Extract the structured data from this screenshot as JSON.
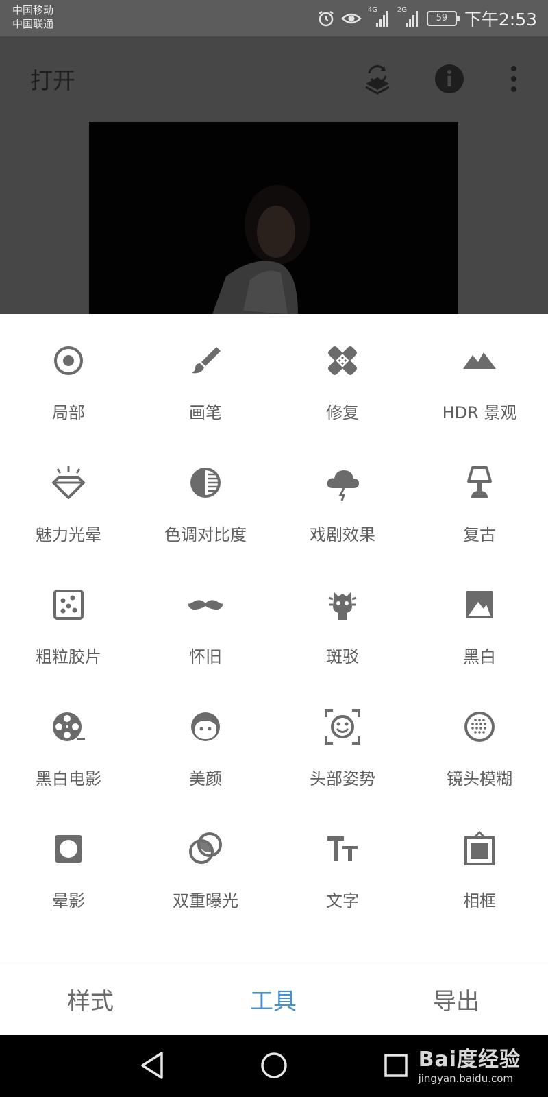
{
  "status_bar": {
    "carrier_1": "中国移动",
    "carrier_2": "中国联通",
    "network_1": "4G",
    "network_2": "2G",
    "battery": "59",
    "time": "下午2:53",
    "icons": [
      "alarm-icon",
      "eye-icon",
      "signal-icon",
      "signal-icon",
      "battery-icon"
    ]
  },
  "header": {
    "open_label": "打开",
    "actions": [
      "layers-icon",
      "info-icon",
      "more-icon"
    ]
  },
  "tools": [
    {
      "label": "局部",
      "icon": "selective-icon"
    },
    {
      "label": "画笔",
      "icon": "brush-icon"
    },
    {
      "label": "修复",
      "icon": "healing-icon"
    },
    {
      "label": "HDR 景观",
      "icon": "mountains-icon"
    },
    {
      "label": "魅力光晕",
      "icon": "diamond-icon"
    },
    {
      "label": "色调对比度",
      "icon": "tonal-contrast-icon"
    },
    {
      "label": "戏剧效果",
      "icon": "cloud-lightning-icon"
    },
    {
      "label": "复古",
      "icon": "lamp-icon"
    },
    {
      "label": "粗粒胶片",
      "icon": "grain-icon"
    },
    {
      "label": "怀旧",
      "icon": "mustache-icon"
    },
    {
      "label": "斑驳",
      "icon": "guitar-icon"
    },
    {
      "label": "黑白",
      "icon": "bw-photo-icon"
    },
    {
      "label": "黑白电影",
      "icon": "film-reel-icon"
    },
    {
      "label": "美颜",
      "icon": "face-icon"
    },
    {
      "label": "头部姿势",
      "icon": "face-frame-icon"
    },
    {
      "label": "镜头模糊",
      "icon": "lens-blur-icon"
    },
    {
      "label": "晕影",
      "icon": "vignette-icon"
    },
    {
      "label": "双重曝光",
      "icon": "double-exposure-icon"
    },
    {
      "label": "文字",
      "icon": "text-icon"
    },
    {
      "label": "相框",
      "icon": "frame-icon"
    }
  ],
  "tabs": [
    {
      "label": "样式",
      "active": false
    },
    {
      "label": "工具",
      "active": true
    },
    {
      "label": "导出",
      "active": false
    }
  ],
  "colors": {
    "accent": "#4a8fd0",
    "icon_gray": "#6b6b6b",
    "label_gray": "#5f5f5f"
  },
  "navigation": {
    "buttons": [
      "back-icon",
      "home-icon",
      "recents-icon"
    ]
  },
  "watermark": {
    "main": "Bai度经验",
    "sub": "jingyan.baidu.com"
  }
}
